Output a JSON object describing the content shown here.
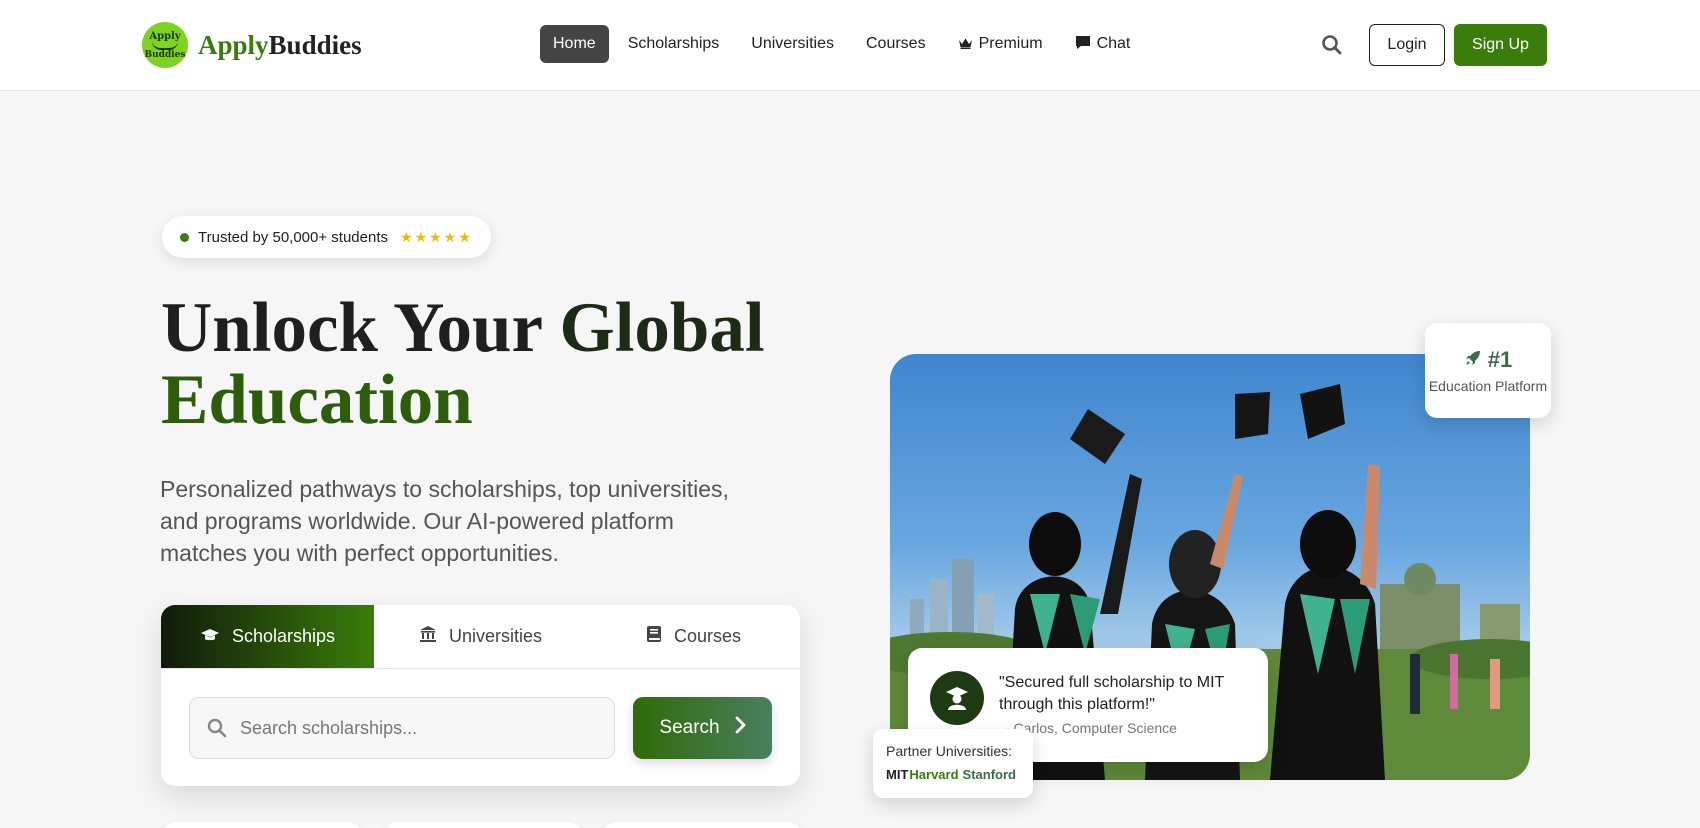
{
  "brand": {
    "badge_top": "Apply",
    "badge_bottom": "Buddies",
    "name_part1": "Apply",
    "name_part2": "Buddies",
    "accent_color": "#3a7d0a"
  },
  "nav": {
    "items": [
      {
        "label": "Home",
        "active": true
      },
      {
        "label": "Scholarships"
      },
      {
        "label": "Universities"
      },
      {
        "label": "Courses"
      },
      {
        "label": "Premium",
        "icon": "crown-icon"
      },
      {
        "label": "Chat",
        "icon": "chat-icon"
      }
    ],
    "login": "Login",
    "signup": "Sign Up"
  },
  "hero": {
    "trust_text": "Trusted by 50,000+ students",
    "stars": "★★★★★",
    "title_line1_a": "Unlock Your ",
    "title_line1_b": "Global",
    "title_line2": "Education",
    "description": "Personalized pathways to scholarships, top universities, and programs worldwide. Our AI-powered platform matches you with perfect opportunities."
  },
  "search": {
    "tabs": [
      {
        "label": "Scholarships",
        "icon": "graduation-cap-icon",
        "active": true
      },
      {
        "label": "Universities",
        "icon": "institution-icon"
      },
      {
        "label": "Courses",
        "icon": "book-icon"
      }
    ],
    "placeholder": "Search scholarships...",
    "button": "Search"
  },
  "stats_card": {
    "rank": "#1",
    "label": "Education Platform"
  },
  "testimonial": {
    "quote": "\"Secured full scholarship to MIT through this platform!\"",
    "author": "- Carlos, Computer Science"
  },
  "partners": {
    "label": "Partner Universities:",
    "list": [
      "MIT",
      "Harvard",
      "Stanford"
    ]
  }
}
